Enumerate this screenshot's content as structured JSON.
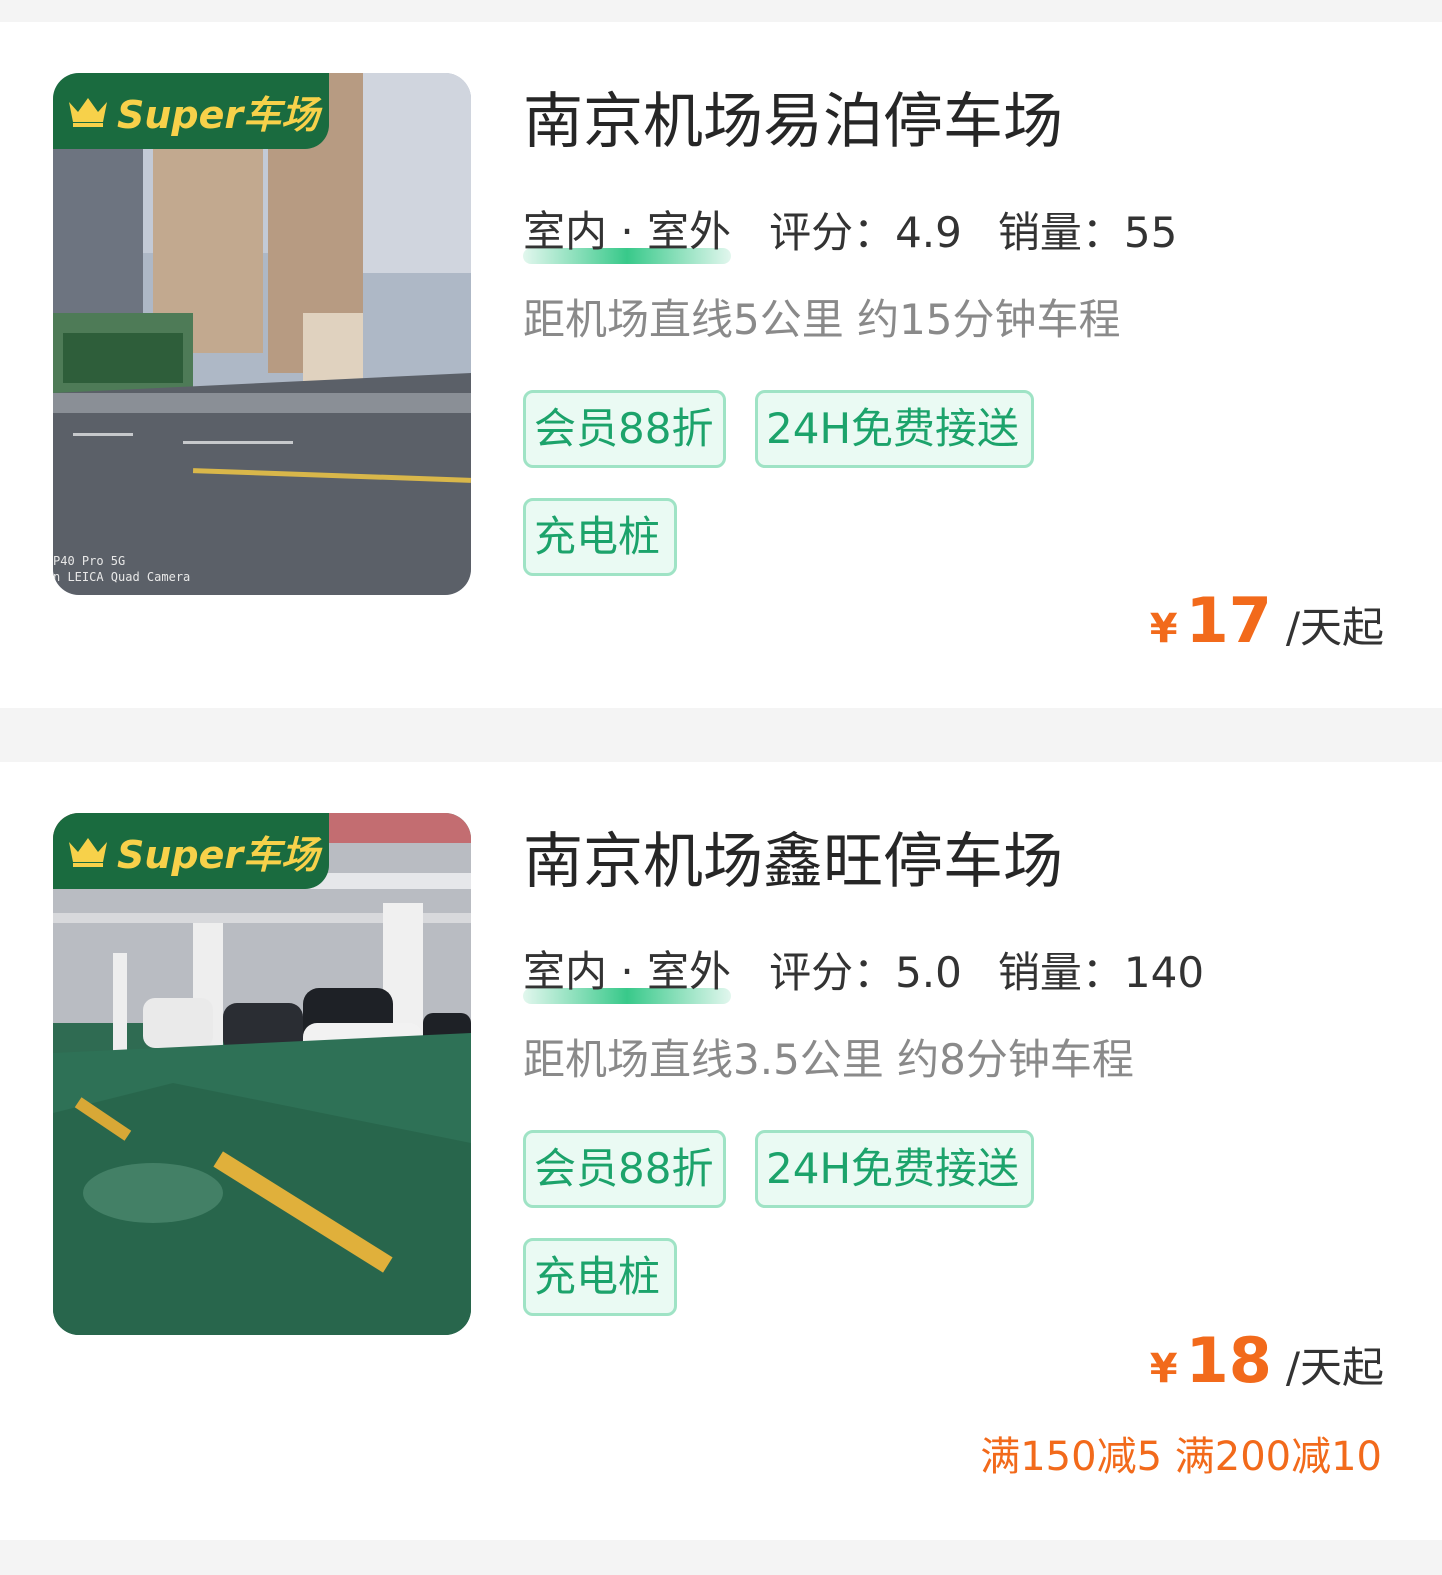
{
  "lots": [
    {
      "badge": "Super车场",
      "name": "南京机场易泊停车场",
      "type": "室内 · 室外",
      "rating_label": "评分：",
      "rating": "4.9",
      "sales_label": "销量：",
      "sales": "55",
      "distance": "距机场直线5公里 约15分钟车程",
      "tags": [
        "会员88折",
        "24H免费接送",
        "充电桩"
      ],
      "currency": "¥",
      "price": "17",
      "unit": "/天起",
      "promo": "",
      "photo_caption_1": "P40 Pro 5G",
      "photo_caption_2": "n LEICA Quad Camera"
    },
    {
      "badge": "Super车场",
      "name": "南京机场鑫旺停车场",
      "type": "室内 · 室外",
      "rating_label": "评分：",
      "rating": "5.0",
      "sales_label": "销量：",
      "sales": "140",
      "distance": "距机场直线3.5公里 约8分钟车程",
      "tags": [
        "会员88折",
        "24H免费接送",
        "充电桩"
      ],
      "currency": "¥",
      "price": "18",
      "unit": "/天起",
      "promo": "满150减5 满200减10"
    }
  ],
  "colors": {
    "accent_green": "#1ca36b",
    "price_orange": "#f26a1b",
    "badge_green": "#1a6b3f",
    "badge_gold": "#f7d14a"
  }
}
